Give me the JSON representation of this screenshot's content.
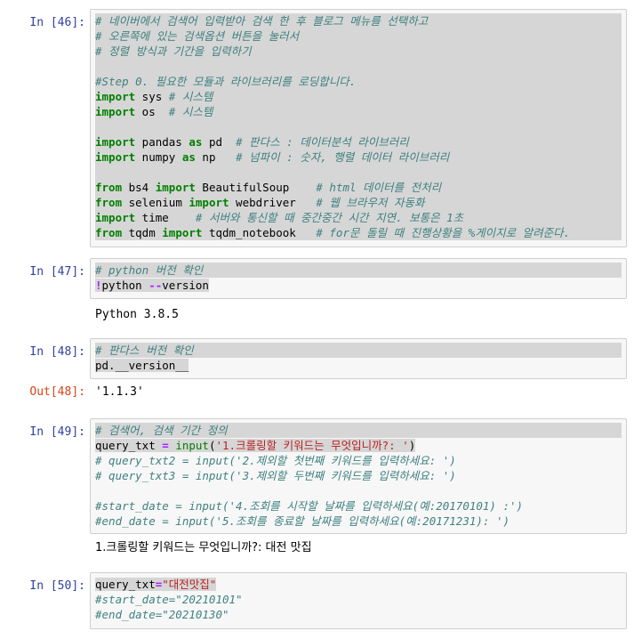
{
  "cells": [
    {
      "prompt": "In [46]:",
      "lines": [
        "# 네이버에서 검색어 입력받아 검색 한 후 블로그 메뉴를 선택하고",
        "# 오른쪽에 있는 검색옵션 버튼을 눌러서",
        "# 정렬 방식과 기간을 입력하기",
        "",
        "#Step 0. 필요한 모듈과 라이브러리를 로딩합니다.",
        "import sys # 시스템",
        "import os  # 시스템",
        "",
        "import pandas as pd  # 판다스 : 데이터분석 라이브러리",
        "import numpy as np   # 넘파이 : 숫자, 행렬 데이터 라이브러리",
        "",
        "from bs4 import BeautifulSoup    # html 데이터를 전처리",
        "from selenium import webdriver   # 웹 브라우저 자동화",
        "import time    # 서버와 통신할 때 중간중간 시간 지연. 보통은 1초",
        "from tqdm import tqdm_notebook   # for문 돌릴 때 진행상황을 %게이지로 알려준다."
      ]
    },
    {
      "prompt": "In [47]:",
      "lines": [
        "# python 버전 확인",
        "!python --version"
      ],
      "output": "Python 3.8.5"
    },
    {
      "prompt": "In [48]:",
      "lines": [
        "# 판다스 버전 확인",
        "pd.__version__"
      ],
      "out_prompt": "Out[48]:",
      "output": "'1.1.3'"
    },
    {
      "prompt": "In [49]:",
      "lines": [
        "# 검색어, 검색 기간 정의",
        "query_txt = input('1.크롤링할 키워드는 무엇입니까?: ')",
        "# query_txt2 = input('2.제외할 첫번째 키워드를 입력하세요: ')",
        "# query_txt3 = input('3.제외할 두번째 키워드를 입력하세요: ')",
        "",
        "#start_date = input('4.조회를 시작할 날짜를 입력하세요(예:20170101) :')",
        "#end_date = input('5.조회를 종료할 날짜를 입력하세요(예:20171231): ')"
      ],
      "output": "1.크롤링할 키워드는 무엇입니까?: 대전 맛집"
    },
    {
      "prompt": "In [50]:",
      "lines": [
        "query_txt=\"대전맛집\"",
        "#start_date=\"20210101\"",
        "#end_date=\"20210130\""
      ]
    }
  ]
}
